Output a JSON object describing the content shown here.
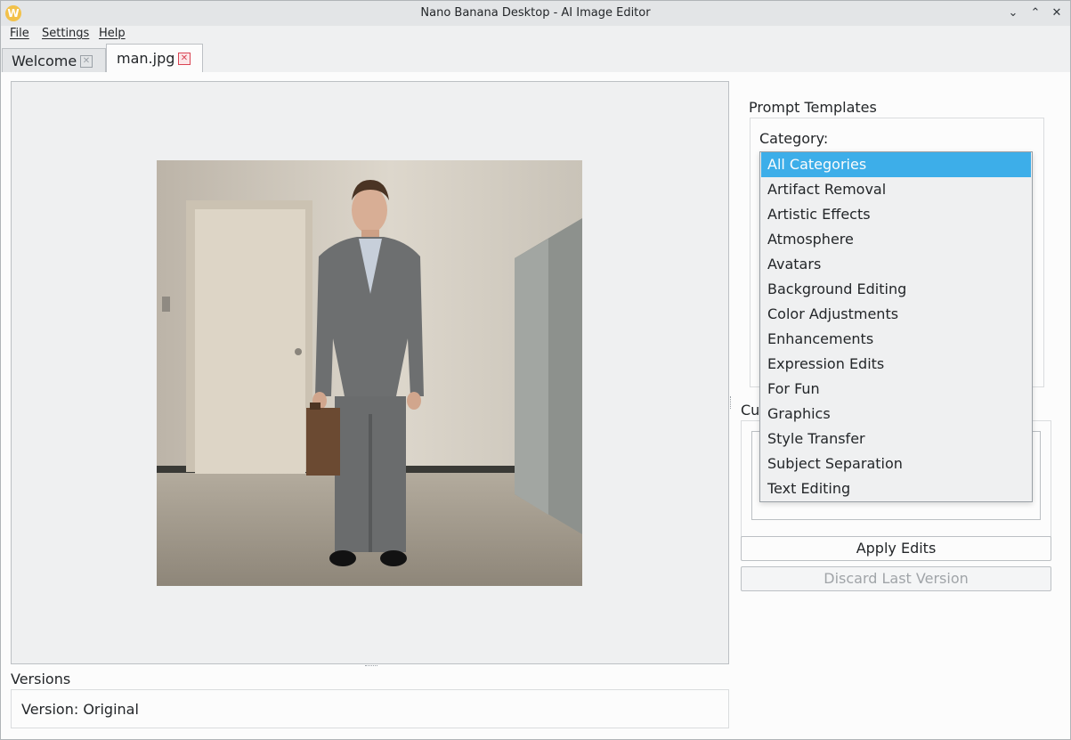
{
  "window": {
    "title": "Nano Banana Desktop - AI Image Editor",
    "icon_letter": "W"
  },
  "menu": [
    "File",
    "Settings",
    "Help"
  ],
  "tabs": [
    {
      "label": "Welcome",
      "active": false
    },
    {
      "label": "man.jpg",
      "active": true
    }
  ],
  "versions": {
    "label": "Versions",
    "current": "Version: Original"
  },
  "prompt_templates": {
    "title": "Prompt Templates",
    "category_label": "Category:",
    "selected": "All Categories",
    "options": [
      "All Categories",
      "Artifact Removal",
      "Artistic Effects",
      "Atmosphere",
      "Avatars",
      "Background Editing",
      "Color Adjustments",
      "Enhancements",
      "Expression Edits",
      "For Fun",
      "Graphics",
      "Style Transfer",
      "Subject Separation",
      "Text Editing"
    ]
  },
  "custom": {
    "label_visible": "Cu"
  },
  "buttons": {
    "apply": "Apply Edits",
    "discard": "Discard Last Version"
  },
  "colors": {
    "selection": "#3daee9",
    "close_active": "#da4453"
  }
}
